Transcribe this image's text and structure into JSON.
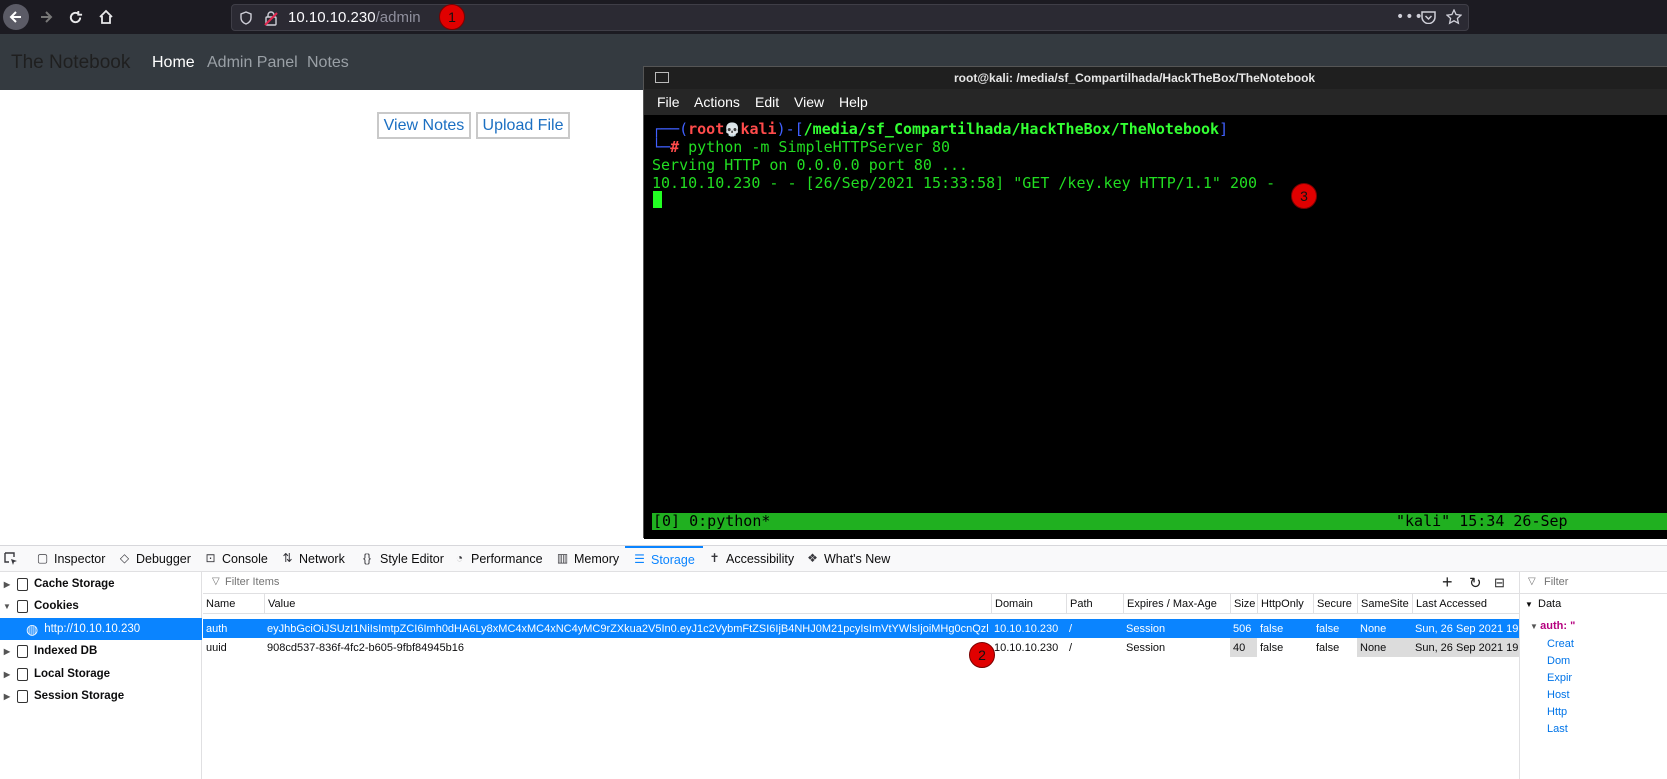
{
  "browser": {
    "url_host": "10.10.10.230",
    "url_path": "/admin",
    "markers": [
      "1",
      "2",
      "3"
    ]
  },
  "site": {
    "brand": "The Notebook",
    "nav": [
      "Home",
      "Admin Panel",
      "Notes"
    ],
    "buttons": [
      "View Notes",
      "Upload File"
    ]
  },
  "terminal": {
    "title": "root@kali: /media/sf_Compartilhada/HackTheBox/TheNotebook",
    "menu": [
      "File",
      "Actions",
      "Edit",
      "View",
      "Help"
    ],
    "prompt": {
      "user": "root",
      "skull": "💀",
      "host": "kali",
      "cwd": "/media/sf_Compartilhada/HackTheBox/TheNotebook",
      "hash": "#",
      "command": "python -m SimpleHTTPServer 80"
    },
    "output": [
      "Serving HTTP on 0.0.0.0 port 80 ...",
      "10.10.10.230 - - [26/Sep/2021 15:33:58] \"GET /key.key HTTP/1.1\" 200 -"
    ],
    "status_left": "[0] 0:python*",
    "status_right": "\"kali\" 15:34 26-Sep"
  },
  "devtools": {
    "tabs": [
      "Inspector",
      "Debugger",
      "Console",
      "Network",
      "Style Editor",
      "Performance",
      "Memory",
      "Storage",
      "Accessibility",
      "What's New"
    ],
    "active_tab": "Storage",
    "tree": [
      "Cache Storage",
      "Cookies",
      "http://10.10.10.230",
      "Indexed DB",
      "Local Storage",
      "Session Storage"
    ],
    "filter_placeholder": "Filter Items",
    "columns": [
      "Name",
      "Value",
      "Domain",
      "Path",
      "Expires / Max-Age",
      "Size",
      "HttpOnly",
      "Secure",
      "SameSite",
      "Last Accessed"
    ],
    "rows": [
      {
        "name": "auth",
        "value": "eyJhbGciOiJSUzI1NiIsImtpZCI6Imh0dHA6Ly8xMC4xMC4xNC4yMC9rZXkua2V5In0.eyJ1c2VybmFtZSI6IjB4NHJ0M21pcyIsImVtYWlsIjoiMHg0cnQzbWlz...",
        "domain": "10.10.10.230",
        "path": "/",
        "expires": "Session",
        "size": "506",
        "httponly": "false",
        "secure": "false",
        "samesite": "None",
        "last_accessed": "Sun, 26 Sep 2021 19..."
      },
      {
        "name": "uuid",
        "value": "908cd537-836f-4fc2-b605-9fbf84945b16",
        "domain": "10.10.10.230",
        "path": "/",
        "expires": "Session",
        "size": "40",
        "httponly": "false",
        "secure": "false",
        "samesite": "None",
        "last_accessed": "Sun, 26 Sep 2021 19..."
      }
    ],
    "sidebar": {
      "filter_placeholder": "Filter",
      "header": "Data",
      "items": [
        "auth: \"",
        "Creat",
        "Dom",
        "Expir",
        "Host",
        "Http",
        "Last"
      ]
    }
  }
}
